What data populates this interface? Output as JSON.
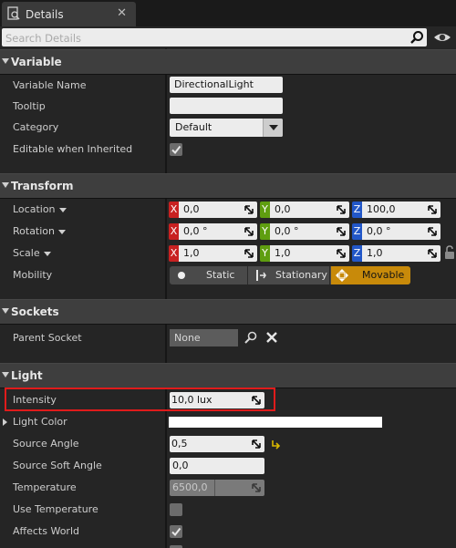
{
  "tab": {
    "label": "Details",
    "icon": "details-icon",
    "close": "✕"
  },
  "search": {
    "placeholder": "Search Details"
  },
  "categories": {
    "variable": {
      "title": "Variable",
      "variable_name_label": "Variable Name",
      "variable_name_value": "DirectionalLight",
      "tooltip_label": "Tooltip",
      "tooltip_value": "",
      "category_label": "Category",
      "category_value": "Default",
      "editable_label": "Editable when Inherited",
      "editable_checked": true
    },
    "transform": {
      "title": "Transform",
      "location_label": "Location",
      "location": {
        "x": "0,0",
        "y": "0,0",
        "z": "100,0"
      },
      "rotation_label": "Rotation",
      "rotation": {
        "x": "0,0 °",
        "y": "0,0 °",
        "z": "0,0 °"
      },
      "scale_label": "Scale",
      "scale": {
        "x": "1,0",
        "y": "1,0",
        "z": "1,0"
      },
      "mobility_label": "Mobility",
      "mobility_options": [
        "Static",
        "Stationary",
        "Movable"
      ],
      "mobility_selected": "Movable",
      "axis_labels": {
        "x": "X",
        "y": "Y",
        "z": "Z"
      }
    },
    "sockets": {
      "title": "Sockets",
      "parent_socket_label": "Parent Socket",
      "parent_socket_value": "None"
    },
    "light": {
      "title": "Light",
      "intensity_label": "Intensity",
      "intensity_value": "10,0 lux",
      "light_color_label": "Light Color",
      "light_color_value": "#ffffff",
      "source_angle_label": "Source Angle",
      "source_angle_value": "0,5",
      "source_soft_angle_label": "Source Soft Angle",
      "source_soft_angle_value": "0,0",
      "temperature_label": "Temperature",
      "temperature_value": "6500,0",
      "use_temperature_label": "Use Temperature",
      "use_temperature_checked": false,
      "affects_world_label": "Affects World",
      "affects_world_checked": true
    }
  },
  "colors": {
    "highlight": "#e01b1b",
    "movable_accent": "#c88a0a",
    "axis_x": "#c82121",
    "axis_y": "#5f9e10",
    "axis_z": "#2257c8"
  }
}
